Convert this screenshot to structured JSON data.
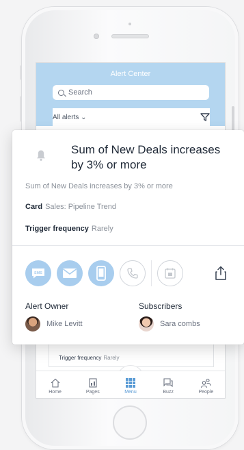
{
  "app": {
    "title": "Alert Center",
    "search_placeholder": "Search",
    "filter_label": "All alerts ⌄"
  },
  "alert": {
    "title": "Sum of New Deals increases by 3% or more",
    "description": "Sum of New Deals increases by 3% or more",
    "card_label": "Card",
    "card_value": "Sales: Pipeline Trend",
    "frequency_label": "Trigger frequency",
    "frequency_value": "Rarely"
  },
  "channels": [
    {
      "name": "sms",
      "icon": "sms-icon",
      "text": "SMS",
      "enabled": true
    },
    {
      "name": "email",
      "icon": "mail-icon",
      "enabled": true
    },
    {
      "name": "mobile",
      "icon": "mobile-icon",
      "enabled": true
    },
    {
      "name": "phone",
      "icon": "phone-icon",
      "enabled": false
    },
    {
      "name": "calendar",
      "icon": "calendar-icon",
      "enabled": false
    }
  ],
  "owner": {
    "label": "Alert Owner",
    "name": "Mike Levitt"
  },
  "subscribers": {
    "label": "Subscribers",
    "name": "Sara combs"
  },
  "background_card": {
    "frequency_label": "Trigger frequency",
    "frequency_value": "Rarely"
  },
  "tabbar": {
    "items": [
      {
        "label": "Home",
        "icon": "home-icon"
      },
      {
        "label": "Pages",
        "icon": "pages-icon"
      },
      {
        "label": "Menu",
        "icon": "grid-icon",
        "active": true
      },
      {
        "label": "Buzz",
        "icon": "chat-icon"
      },
      {
        "label": "People",
        "icon": "people-icon"
      }
    ]
  },
  "colors": {
    "header_bg": "#b4d6f0",
    "channel_active": "#a8cdee",
    "accent": "#5a9bd5"
  }
}
